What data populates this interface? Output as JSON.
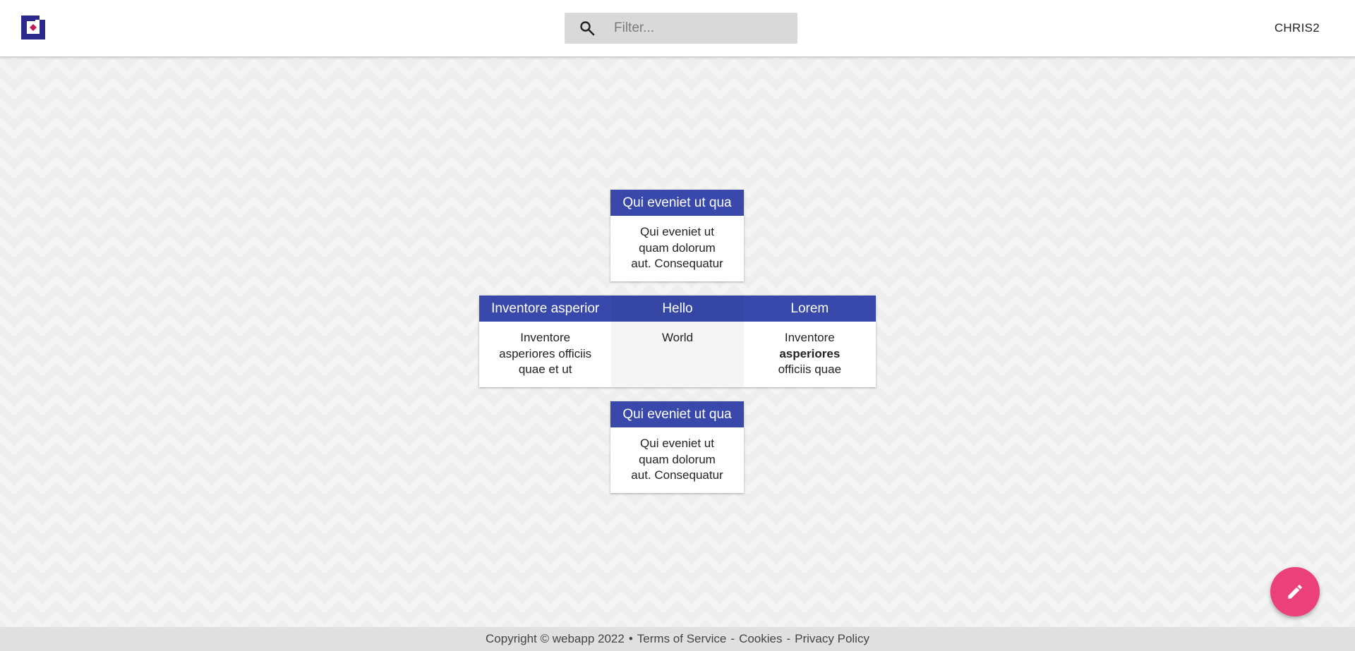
{
  "header": {
    "search_placeholder": "Filter...",
    "user_name": "CHRIS2"
  },
  "cards": {
    "top": {
      "title": "Qui eveniet ut qua",
      "body_lines": [
        "Qui eveniet ut",
        "quam dolorum",
        "aut. Consequatur"
      ]
    },
    "left": {
      "title": "Inventore asperior",
      "body_lines": [
        "Inventore",
        "asperiores officiis",
        "quae et ut"
      ]
    },
    "middle": {
      "title": "Hello",
      "body_lines": [
        "World"
      ]
    },
    "right": {
      "title": "Lorem",
      "body_lines": [
        "Inventore",
        "asperiores",
        "officiis quae"
      ]
    },
    "bottom": {
      "title": "Qui eveniet ut qua",
      "body_lines": [
        "Qui eveniet ut",
        "quam dolorum",
        "aut. Consequatur"
      ]
    }
  },
  "footer": {
    "copyright": "Copyright © webapp 2022",
    "bullet": "•",
    "dash": "-",
    "terms": "Terms of Service",
    "cookies": "Cookies",
    "privacy": "Privacy Policy"
  },
  "colors": {
    "card_header": "#3949ab",
    "fab": "#ec407a",
    "logo": "#2b2a8c",
    "logo_accent": "#c2185b"
  },
  "icons": {
    "logo": "app-logo",
    "search": "search-icon",
    "fab": "edit-icon"
  }
}
